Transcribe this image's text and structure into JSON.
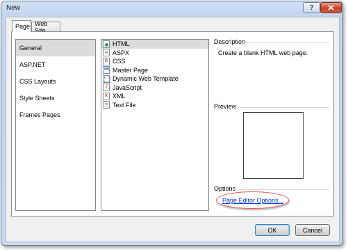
{
  "window": {
    "title": "New",
    "help_label": "?",
    "close_label": "x"
  },
  "tabs": [
    {
      "label": "Page",
      "active": true
    },
    {
      "label": "Web Site",
      "active": false
    }
  ],
  "categories": [
    {
      "label": "General",
      "selected": true
    },
    {
      "label": "ASP.NET",
      "selected": false
    },
    {
      "label": "CSS Layouts",
      "selected": false
    },
    {
      "label": "Style Sheets",
      "selected": false
    },
    {
      "label": "Frames Pages",
      "selected": false
    }
  ],
  "templates": [
    {
      "label": "HTML",
      "icon": "html-file-icon",
      "selected": true
    },
    {
      "label": "ASPX",
      "icon": "aspx-file-icon",
      "selected": false
    },
    {
      "label": "CSS",
      "icon": "css-file-icon",
      "selected": false
    },
    {
      "label": "Master Page",
      "icon": "master-page-icon",
      "selected": false
    },
    {
      "label": "Dynamic Web Template",
      "icon": "dynamic-web-template-icon",
      "selected": false
    },
    {
      "label": "JavaScript",
      "icon": "javascript-file-icon",
      "selected": false
    },
    {
      "label": "XML",
      "icon": "xml-file-icon",
      "selected": false
    },
    {
      "label": "Text File",
      "icon": "text-file-icon",
      "selected": false
    }
  ],
  "description": {
    "label": "Description",
    "text": "Create a blank HTML web page."
  },
  "preview": {
    "label": "Preview"
  },
  "options": {
    "label": "Options",
    "link": "Page Editor Options..."
  },
  "buttons": {
    "ok": "OK",
    "cancel": "Cancel"
  },
  "colors": {
    "highlight_oval": "#e0534a",
    "link": "#0033cc",
    "selection": "#dcdcdc"
  }
}
